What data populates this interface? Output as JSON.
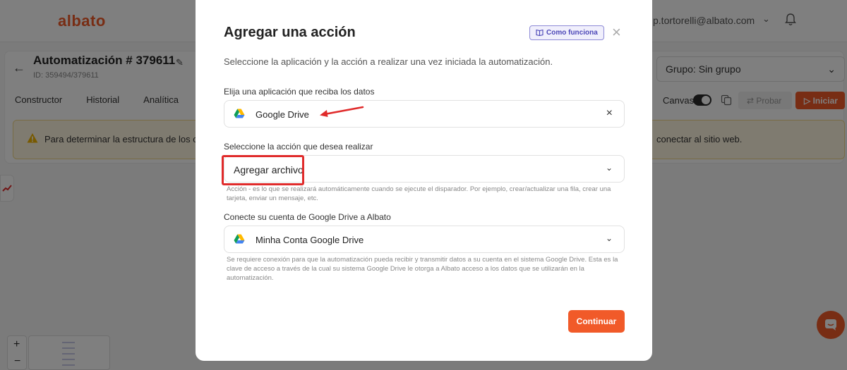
{
  "app": {
    "logo": "albato",
    "user_email": "p.tortorelli@albato.com",
    "automation_title": "Automatización # 379611",
    "automation_id": "ID: 359494/379611",
    "tabs": [
      "Constructor",
      "Historial",
      "Analítica"
    ],
    "group_select": "Grupo: Sin grupo",
    "canvas_label": "Canvas",
    "probar_label": "Probar",
    "iniciar_label": "Iniciar",
    "warning_left": "Para determinar la estructura de los c",
    "warning_right": "conectar al sitio web.",
    "accent_color": "#f15a29"
  },
  "modal": {
    "title": "Agregar una acción",
    "how_it_works": "Como funciona",
    "subtitle": "Seleccione la aplicación y la acción a realizar una vez iniciada la automatización.",
    "app_field": {
      "label": "Elija una aplicación que reciba los datos",
      "value": "Google Drive"
    },
    "action_field": {
      "label": "Seleccione la acción que desea realizar",
      "value": "Agregar archivo",
      "hint": "Acción - es lo que se realizará automáticamente cuando se ejecute el disparador. Por ejemplo, crear/actualizar una fila, crear una tarjeta, enviar un mensaje, etc."
    },
    "account_field": {
      "label": "Conecte su cuenta de Google Drive a Albato",
      "value": "Minha Conta Google Drive",
      "hint": "Se requiere conexión para que la automatización pueda recibir y transmitir datos a su cuenta en el sistema Google Drive. Esta es la clave de acceso a través de la cual su sistema Google Drive le otorga a Albato acceso a los datos que se utilizarán en la automatización."
    },
    "continue_label": "Continuar"
  },
  "annotations": {
    "highlight_color": "#e02b2b"
  }
}
